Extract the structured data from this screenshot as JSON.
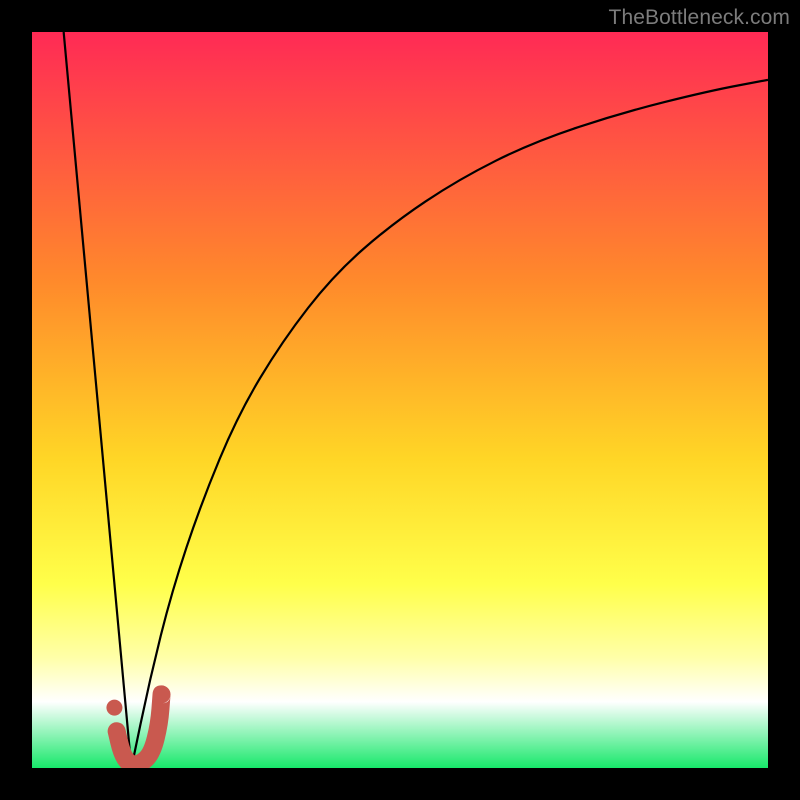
{
  "attribution": "TheBottleneck.com",
  "colors": {
    "frame": "#000000",
    "grad_top": "#ff2a55",
    "grad_mid1": "#ff8a2b",
    "grad_mid2": "#ffd626",
    "grad_mid3": "#ffff4a",
    "grad_pale": "#ffffa8",
    "grad_white": "#ffffff",
    "grad_bottom": "#17e86a",
    "curve": "#000000",
    "marker": "#c9594f"
  },
  "chart_data": {
    "type": "line",
    "title": "",
    "xlabel": "",
    "ylabel": "",
    "xlim": [
      0,
      100
    ],
    "ylim": [
      0,
      100
    ],
    "series": [
      {
        "name": "bottleneck-curve-left",
        "x": [
          4.3,
          13.5
        ],
        "y": [
          100,
          0
        ],
        "style": "line"
      },
      {
        "name": "bottleneck-curve-right",
        "x": [
          13.5,
          16,
          19,
          23,
          28,
          34,
          41,
          49,
          58,
          68,
          80,
          92,
          100
        ],
        "y": [
          0,
          12,
          24,
          36,
          48,
          58,
          67,
          74,
          80,
          85,
          89,
          92,
          93.5
        ],
        "style": "line"
      },
      {
        "name": "highlight-j",
        "x": [
          11.5,
          12.2,
          13.2,
          14.7,
          16.3,
          17.3,
          17.6
        ],
        "y": [
          5,
          2,
          0.5,
          0.5,
          2,
          6,
          10
        ],
        "style": "thick-line"
      },
      {
        "name": "highlight-dot",
        "x": [
          11.2
        ],
        "y": [
          8.2
        ],
        "style": "point"
      }
    ],
    "gradient_stops": [
      {
        "pct": 0,
        "color": "#ff2a55"
      },
      {
        "pct": 34,
        "color": "#ff8a2b"
      },
      {
        "pct": 58,
        "color": "#ffd626"
      },
      {
        "pct": 75,
        "color": "#ffff4a"
      },
      {
        "pct": 85,
        "color": "#ffffa8"
      },
      {
        "pct": 91,
        "color": "#ffffff"
      },
      {
        "pct": 100,
        "color": "#17e86a"
      }
    ]
  }
}
